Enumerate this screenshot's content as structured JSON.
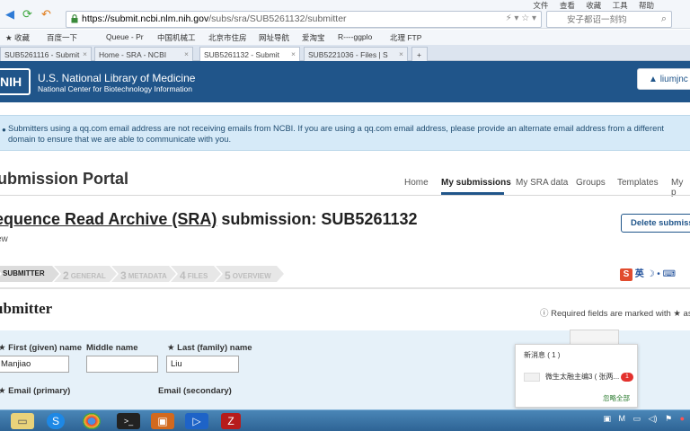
{
  "browser": {
    "url": "https://submit.ncbi.nlm.nih.gov/subs/sra/SUB5261132/submitter",
    "url_host": "https://submit.ncbi.nlm.nih.gov",
    "url_path": "/subs/sra/SUB5261132/submitter",
    "menu": [
      "文件",
      "查看",
      "收藏",
      "工具",
      "帮助"
    ],
    "search_placeholder": "安子都诏一刻钧",
    "bookmarks": [
      "收藏",
      "百度一下",
      "Queue - Pr",
      "中国机械工",
      "北京市住房",
      "网址导航",
      "爱淘宝",
      "R----ggplo",
      "北理 FTP"
    ],
    "tabs": [
      {
        "label": "SUB5261116 - Submit",
        "active": false
      },
      {
        "label": "Home - SRA - NCBI",
        "active": false
      },
      {
        "label": "SUB5261132 - Submit",
        "active": true
      },
      {
        "label": "SUB5221036 - Files | S",
        "active": false
      },
      {
        "label": "+",
        "active": false
      }
    ]
  },
  "header": {
    "logo": "NIH",
    "org_name": "U.S. National Library of Medicine",
    "org_sub": "National Center for Biotechnology Information",
    "user": "liumjnc"
  },
  "notice": "Submitters using a qq.com email address are not receiving emails from NCBI. If you are using a qq.com email address, please provide an alternate email address from a different domain to ensure that we are able to communicate with you.",
  "portal": {
    "title": "ubmission Portal",
    "nav": [
      {
        "label": "Home",
        "active": false
      },
      {
        "label": "My submissions",
        "active": true
      },
      {
        "label": "My SRA data",
        "active": false
      },
      {
        "label": "Groups",
        "active": false
      },
      {
        "label": "Templates",
        "active": false
      },
      {
        "label": "My p",
        "active": false
      }
    ]
  },
  "submission": {
    "title_link": "equence Read Archive (SRA)",
    "title_rest": " submission: SUB5261132",
    "subtitle": "ew",
    "delete_label": "Delete submissi"
  },
  "steps": [
    {
      "num": "",
      "label": "SUBMITTER",
      "done": true
    },
    {
      "num": "2",
      "label": "GENERAL",
      "done": false
    },
    {
      "num": "3",
      "label": "METADATA",
      "done": false
    },
    {
      "num": "4",
      "label": "FILES",
      "done": false
    },
    {
      "num": "5",
      "label": "OVERVIEW",
      "done": false
    }
  ],
  "ime": {
    "logo": "S",
    "text": "英"
  },
  "form": {
    "section_title": "ubmitter",
    "required_note": "Required fields are marked with ★ ast",
    "first_name_label": "First (given) name",
    "first_name_value": "Manjiao",
    "middle_name_label": "Middle name",
    "middle_name_value": "",
    "last_name_label": "Last (family) name",
    "last_name_value": "Liu",
    "email_primary_label": "Email (primary)",
    "email_secondary_label": "Email (secondary)"
  },
  "popup": {
    "title": "新消息 ( 1 )",
    "message": "微生太融主编3 ( 张两...",
    "badge": "1",
    "ignore": "忽略全部"
  },
  "colors": {
    "nih_blue": "#20558a",
    "notice_bg": "#d6eaf8",
    "form_bg": "#e6f1f9",
    "taskbar": "#2e6495"
  }
}
